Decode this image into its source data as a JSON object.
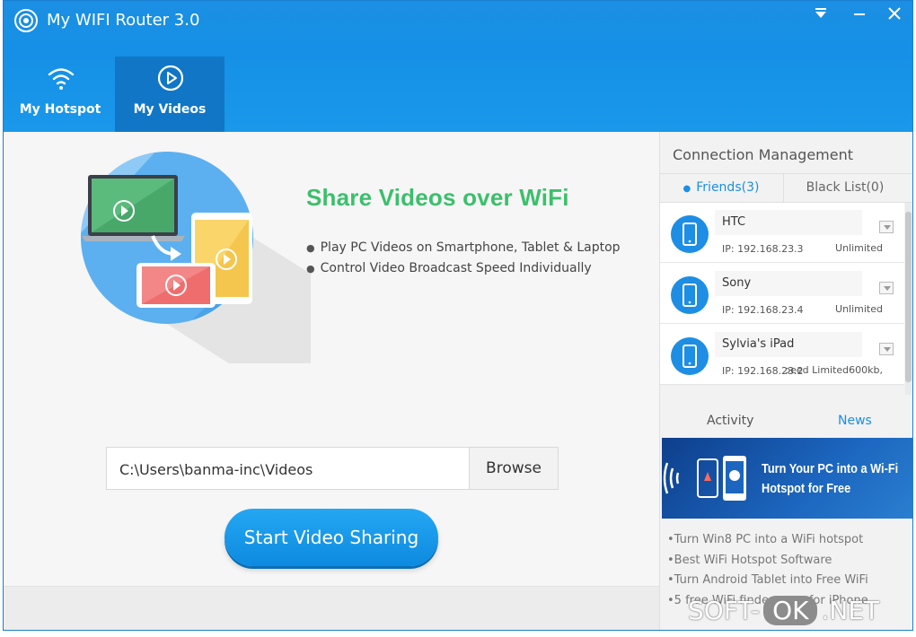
{
  "app": {
    "title": "My WIFI Router 3.0"
  },
  "window_controls": {
    "menu": "▼",
    "minimize": "—",
    "close": "✕"
  },
  "tabs": [
    {
      "label": "My Hotspot",
      "icon": "wifi-icon",
      "active": false
    },
    {
      "label": "My Videos",
      "icon": "play-circle-icon",
      "active": true
    }
  ],
  "main": {
    "headline": "Share Videos over WiFi",
    "features": [
      "Play PC Videos on Smartphone, Tablet & Laptop",
      "Control Video Broadcast Speed Individually"
    ],
    "path_value": "C:\\Users\\banma-inc\\Videos",
    "browse_label": "Browse",
    "start_label": "Start Video Sharing",
    "accent_color": "#3cbf6c"
  },
  "connection": {
    "title": "Connection Management",
    "tab_friends": "Friends(3)",
    "tab_black": "Black List(0)",
    "devices": [
      {
        "name": "HTC",
        "ip": "IP: 192.168.23.3",
        "speed": "Unlimited"
      },
      {
        "name": "Sony",
        "ip": "IP: 192.168.23.4",
        "speed": "Unlimited"
      },
      {
        "name": "Sylvia's iPad",
        "ip": "IP: 192.168.23.2",
        "speed": "ɔeed Limited600kb,"
      }
    ]
  },
  "info": {
    "tab_activity": "Activity",
    "tab_news": "News",
    "banner_line1": "Turn Your PC into a Wi-Fi",
    "banner_line2": "Hotspot for Free",
    "news": [
      "Turn Win8 PC into a WiFi hotspot",
      "Best WiFi Hotspot Software",
      "Turn Android Tablet into Free WiFi",
      "5 free WiFi finder apps for iPhone"
    ]
  },
  "watermark": {
    "left": "SOFT-",
    "mid": "OK",
    "right": ".NET"
  },
  "colors": {
    "brand_blue": "#1b8fe3",
    "active_tab": "#1176c6",
    "green": "#3cbf6c"
  }
}
